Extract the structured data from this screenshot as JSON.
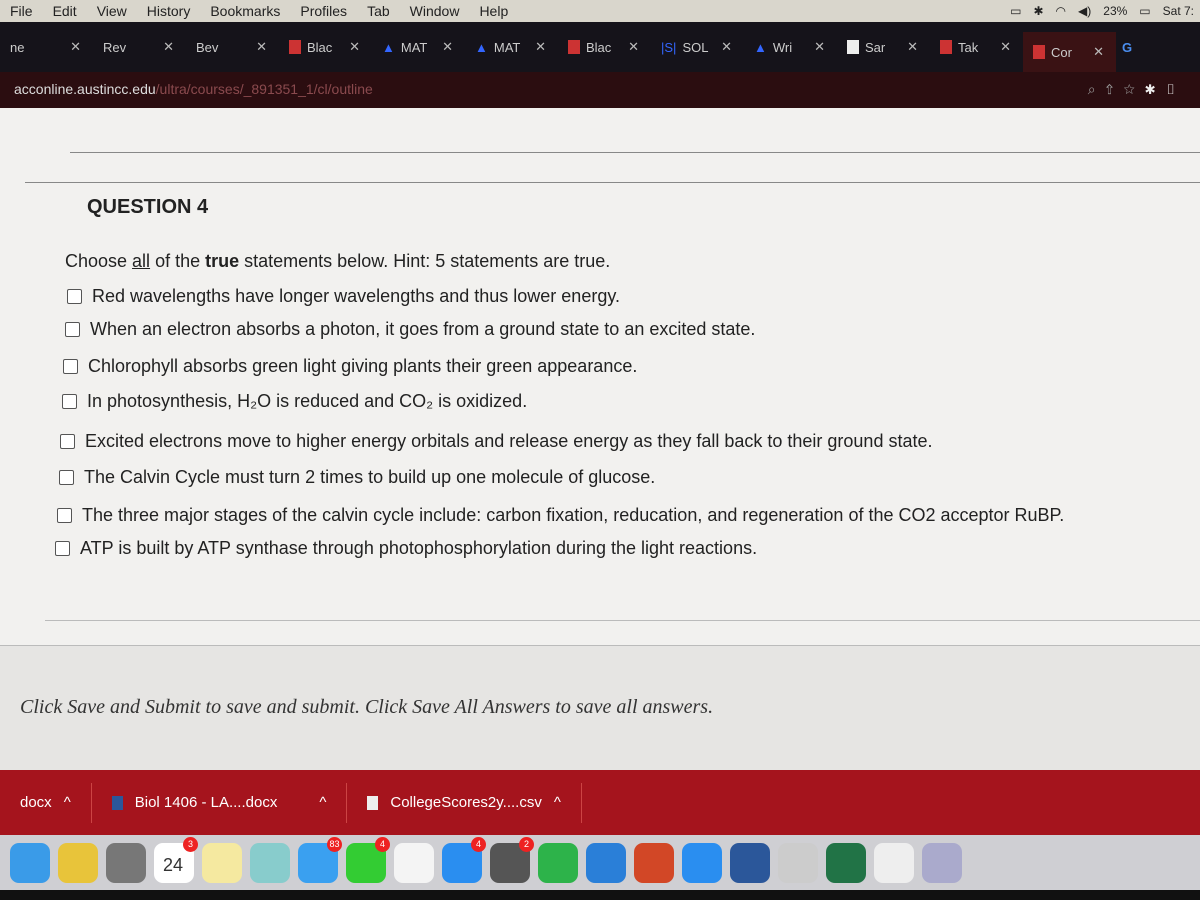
{
  "menubar": {
    "items": [
      "File",
      "Edit",
      "View",
      "History",
      "Bookmarks",
      "Profiles",
      "Tab",
      "Window",
      "Help"
    ],
    "battery": "23%",
    "clock": "Sat 7:"
  },
  "tabs": [
    {
      "label": "ne"
    },
    {
      "label": "Rev"
    },
    {
      "label": "Bev"
    },
    {
      "label": "Blac"
    },
    {
      "label": "MAT"
    },
    {
      "label": "MAT"
    },
    {
      "label": "Blac"
    },
    {
      "label": "SOL"
    },
    {
      "label": "Wri"
    },
    {
      "label": "Sar"
    },
    {
      "label": "Tak"
    },
    {
      "label": "Cor",
      "active": true
    }
  ],
  "address": {
    "host": "acconline.austincc.edu",
    "path": "/ultra/courses/_891351_1/cl/outline"
  },
  "question": {
    "title": "QUESTION 4",
    "instr_pre": "Choose ",
    "instr_all": "all",
    "instr_mid": " of the ",
    "instr_true": "true",
    "instr_post": " statements below. Hint: 5 statements are true.",
    "options": [
      "Red wavelengths have longer wavelengths and thus lower energy.",
      "When an electron absorbs a photon, it goes from a ground state to an excited state.",
      "Chlorophyll absorbs green light giving plants their green appearance.",
      "In photosynthesis, H₂O is reduced and CO₂ is oxidized.",
      "Excited electrons move to higher energy orbitals and release energy as they fall back to their ground state.",
      "The Calvin Cycle must turn 2 times to build up one molecule of glucose.",
      "The three major stages of the calvin cycle include: carbon fixation, reducation, and regeneration of the CO2 acceptor RuBP.",
      "ATP is built by ATP synthase through photophosphorylation during the light reactions."
    ]
  },
  "footer": {
    "text": "Click Save and Submit to save and submit. Click Save All Answers to save all answers."
  },
  "downloads": [
    {
      "name": "docx"
    },
    {
      "name": "Biol 1406 - LA....docx"
    },
    {
      "name": "CollegeScores2y....csv"
    }
  ],
  "dock": {
    "apps": [
      {
        "name": "finder",
        "color": "#3a9be8"
      },
      {
        "name": "chrome",
        "color": "#e8c43a"
      },
      {
        "name": "launchpad",
        "color": "#777"
      },
      {
        "name": "calendar",
        "color": "#fff",
        "badge": "3",
        "text": "24"
      },
      {
        "name": "notes",
        "color": "#f5e9a0"
      },
      {
        "name": "maps",
        "color": "#8cc"
      },
      {
        "name": "messages",
        "color": "#3aa0f0",
        "badge": "83"
      },
      {
        "name": "facetime",
        "color": "#3c3",
        "badge": "4"
      },
      {
        "name": "itunes",
        "color": "#f4f4f4"
      },
      {
        "name": "app-store",
        "color": "#2a8ef0",
        "badge": "4"
      },
      {
        "name": "system-preferences",
        "color": "#555",
        "badge": "2"
      },
      {
        "name": "spotify",
        "color": "#2db34a"
      },
      {
        "name": "vpn",
        "color": "#2a7fd8"
      },
      {
        "name": "powerpoint",
        "color": "#d24726"
      },
      {
        "name": "safari",
        "color": "#2a8ef0"
      },
      {
        "name": "word",
        "color": "#2b579a"
      },
      {
        "name": "keychain",
        "color": "#ccc"
      },
      {
        "name": "excel",
        "color": "#217346"
      },
      {
        "name": "numbers",
        "color": "#eee"
      },
      {
        "name": "preview",
        "color": "#aac"
      }
    ]
  }
}
